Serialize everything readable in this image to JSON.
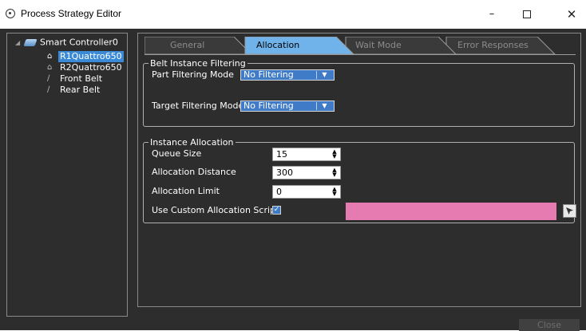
{
  "window": {
    "title": "Process Strategy Editor",
    "minimize_glyph": "–",
    "close_glyph": "✕"
  },
  "tree": {
    "root": {
      "label": "Smart Controller0",
      "icon": "controller-icon",
      "expanded": true
    },
    "items": [
      {
        "label": "R1Quattro650",
        "icon": "robot-icon",
        "selected": true
      },
      {
        "label": "R2Quattro650",
        "icon": "robot-icon",
        "selected": false
      },
      {
        "label": "Front Belt",
        "icon": "belt-icon",
        "selected": false
      },
      {
        "label": "Rear Belt",
        "icon": "belt-icon",
        "selected": false
      }
    ]
  },
  "tabs": [
    {
      "label": "General",
      "active": false
    },
    {
      "label": "Allocation",
      "active": true
    },
    {
      "label": "Wait Mode",
      "active": false
    },
    {
      "label": "Error Responses",
      "active": false
    }
  ],
  "belt_filtering": {
    "title": "Belt Instance Filtering",
    "part_mode_label": "Part Filtering Mode",
    "part_mode_value": "No Filtering",
    "target_mode_label": "Target Filtering Mode",
    "target_mode_value": "No Filtering"
  },
  "instance_allocation": {
    "title": "Instance Allocation",
    "queue_size_label": "Queue Size",
    "queue_size_value": "15",
    "distance_label": "Allocation Distance",
    "distance_value": "300",
    "limit_label": "Allocation Limit",
    "limit_value": "0",
    "custom_script_label": "Use Custom Allocation Script",
    "custom_script_checked": true,
    "custom_script_field_color": "#e57bb1"
  },
  "footer": {
    "close_label": "Close"
  },
  "colors": {
    "active_tab": "#6fb3ea",
    "selection": "#3a8ad8",
    "panel_bg": "#2d2d2d",
    "dropdown_bg": "#3f7bc7"
  }
}
